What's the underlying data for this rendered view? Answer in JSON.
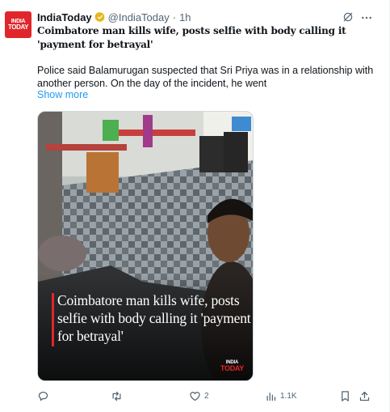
{
  "author": {
    "name": "IndiaToday",
    "handle": "@IndiaToday",
    "separator": "·",
    "time": "1h",
    "avatar_line1": "INDIA",
    "avatar_line2": "TODAY",
    "verified_icon": "verified-gold-icon"
  },
  "headline": "Coimbatore man kills wife, posts selfie with body calling it 'payment for betrayal'",
  "body": "Police said Balamurugan suspected that Sri Priya was in a relationship with another person. On the day of the incident, he went",
  "show_more": "Show more",
  "media": {
    "caption": "Coimbatore man kills wife, posts selfie with body calling it 'payment for betrayal'",
    "watermark_line1": "INDIA",
    "watermark_line2": "TODAY"
  },
  "actions": {
    "reply_count": "",
    "repost_count": "",
    "like_count": "2",
    "views_count": "1.1K"
  },
  "colors": {
    "brand_red": "#e0262b",
    "link_blue": "#1d9bf0",
    "muted": "#536471",
    "verified_gold": "#e2b719"
  }
}
